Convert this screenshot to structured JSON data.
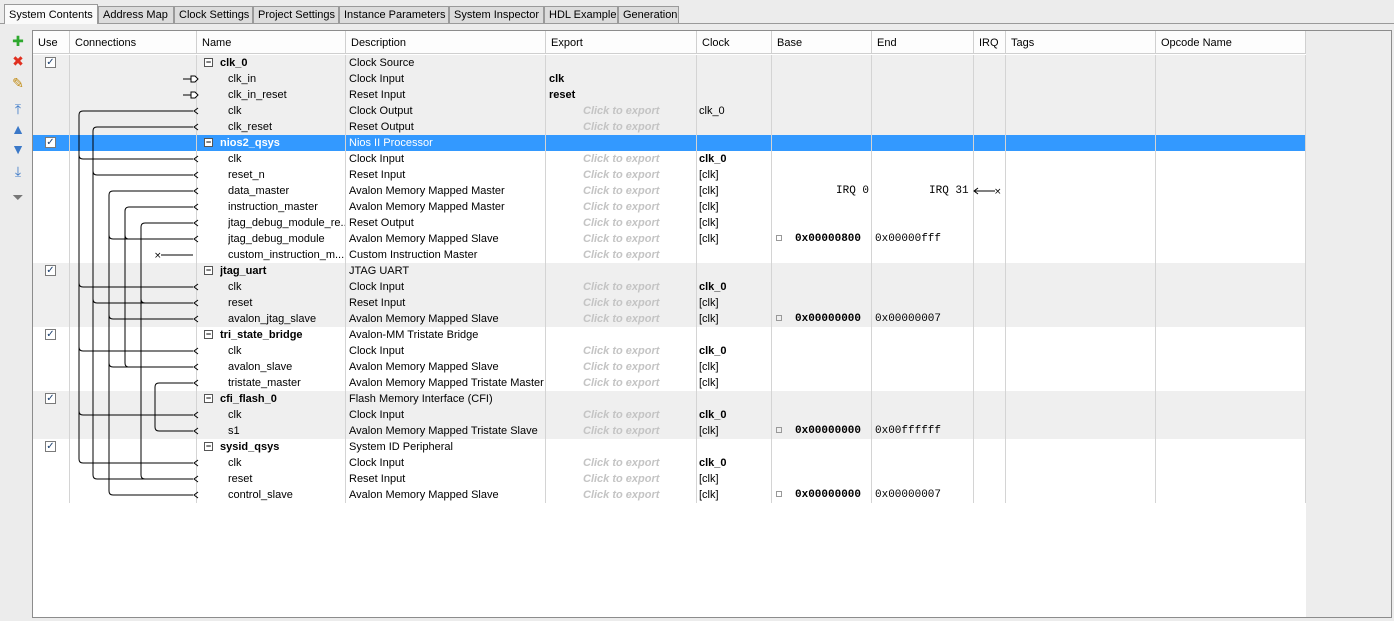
{
  "tabs": [
    {
      "label": "System Contents",
      "active": true
    },
    {
      "label": "Address Map"
    },
    {
      "label": "Clock Settings"
    },
    {
      "label": "Project Settings"
    },
    {
      "label": "Instance Parameters"
    },
    {
      "label": "System Inspector"
    },
    {
      "label": "HDL Example"
    },
    {
      "label": "Generation"
    }
  ],
  "toolbar": [
    {
      "name": "add-icon",
      "glyph": "✚",
      "color": "#2ea82e"
    },
    {
      "name": "remove-icon",
      "glyph": "✖",
      "color": "#e03020"
    },
    {
      "name": "edit-icon",
      "glyph": "✎",
      "color": "#c08a10"
    },
    {
      "name": "move-top-icon",
      "glyph": "⤒",
      "color": "#3a78c8"
    },
    {
      "name": "move-up-icon",
      "glyph": "▲",
      "color": "#3a78c8"
    },
    {
      "name": "move-down-icon",
      "glyph": "▼",
      "color": "#3a78c8"
    },
    {
      "name": "move-bottom-icon",
      "glyph": "⤓",
      "color": "#3a78c8"
    },
    {
      "name": "filter-icon",
      "glyph": "⏷",
      "color": "#777777"
    }
  ],
  "columns": [
    "Use",
    "Connections",
    "Name",
    "Description",
    "Export",
    "Clock",
    "Base",
    "End",
    "IRQ",
    "Tags",
    "Opcode Name"
  ],
  "export_placeholder": "Click to export",
  "rows": [
    {
      "type": "comp",
      "name": "clk_0",
      "desc": "Clock Source",
      "use": true
    },
    {
      "type": "iface",
      "name": "clk_in",
      "desc": "Clock Input",
      "export": "clk",
      "export_bold": true
    },
    {
      "type": "iface",
      "name": "clk_in_reset",
      "desc": "Reset Input",
      "export": "reset",
      "export_bold": true
    },
    {
      "type": "iface",
      "name": "clk",
      "desc": "Clock Output",
      "export_ph": true,
      "clock": "clk_0"
    },
    {
      "type": "iface",
      "name": "clk_reset",
      "desc": "Reset Output",
      "export_ph": true
    },
    {
      "type": "comp",
      "name": "nios2_qsys",
      "desc": "Nios II Processor",
      "use": true,
      "selected": true
    },
    {
      "type": "iface",
      "name": "clk",
      "desc": "Clock Input",
      "export_ph": true,
      "clock": "clk_0",
      "clock_bold": true
    },
    {
      "type": "iface",
      "name": "reset_n",
      "desc": "Reset Input",
      "export_ph": true,
      "clock": "[clk]"
    },
    {
      "type": "iface",
      "name": "data_master",
      "desc": "Avalon Memory Mapped Master",
      "export_ph": true,
      "clock": "[clk]",
      "irq_left": "IRQ 0",
      "irq_right": "IRQ 31"
    },
    {
      "type": "iface",
      "name": "instruction_master",
      "desc": "Avalon Memory Mapped Master",
      "export_ph": true,
      "clock": "[clk]"
    },
    {
      "type": "iface",
      "name": "jtag_debug_module_re...",
      "desc": "Reset Output",
      "export_ph": true,
      "clock": "[clk]"
    },
    {
      "type": "iface",
      "name": "jtag_debug_module",
      "desc": "Avalon Memory Mapped Slave",
      "export_ph": true,
      "clock": "[clk]",
      "base": "0x00000800",
      "end": "0x00000fff"
    },
    {
      "type": "iface",
      "name": "custom_instruction_m...",
      "desc": "Custom Instruction Master",
      "export_ph": true
    },
    {
      "type": "comp",
      "name": "jtag_uart",
      "desc": "JTAG UART",
      "use": true
    },
    {
      "type": "iface",
      "name": "clk",
      "desc": "Clock Input",
      "export_ph": true,
      "clock": "clk_0",
      "clock_bold": true
    },
    {
      "type": "iface",
      "name": "reset",
      "desc": "Reset Input",
      "export_ph": true,
      "clock": "[clk]"
    },
    {
      "type": "iface",
      "name": "avalon_jtag_slave",
      "desc": "Avalon Memory Mapped Slave",
      "export_ph": true,
      "clock": "[clk]",
      "base": "0x00000000",
      "end": "0x00000007"
    },
    {
      "type": "comp",
      "name": "tri_state_bridge",
      "desc": "Avalon-MM Tristate Bridge",
      "use": true
    },
    {
      "type": "iface",
      "name": "clk",
      "desc": "Clock Input",
      "export_ph": true,
      "clock": "clk_0",
      "clock_bold": true
    },
    {
      "type": "iface",
      "name": "avalon_slave",
      "desc": "Avalon Memory Mapped Slave",
      "export_ph": true,
      "clock": "[clk]"
    },
    {
      "type": "iface",
      "name": "tristate_master",
      "desc": "Avalon Memory Mapped Tristate Master",
      "export_ph": true,
      "clock": "[clk]"
    },
    {
      "type": "comp",
      "name": "cfi_flash_0",
      "desc": "Flash Memory Interface (CFI)",
      "use": true
    },
    {
      "type": "iface",
      "name": "clk",
      "desc": "Clock Input",
      "export_ph": true,
      "clock": "clk_0",
      "clock_bold": true
    },
    {
      "type": "iface",
      "name": "s1",
      "desc": "Avalon Memory Mapped Tristate Slave",
      "export_ph": true,
      "clock": "[clk]",
      "base": "0x00000000",
      "end": "0x00ffffff"
    },
    {
      "type": "comp",
      "name": "sysid_qsys",
      "desc": "System ID Peripheral",
      "use": true
    },
    {
      "type": "iface",
      "name": "clk",
      "desc": "Clock Input",
      "export_ph": true,
      "clock": "clk_0",
      "clock_bold": true
    },
    {
      "type": "iface",
      "name": "reset",
      "desc": "Reset Input",
      "export_ph": true,
      "clock": "[clk]"
    },
    {
      "type": "iface",
      "name": "control_slave",
      "desc": "Avalon Memory Mapped Slave",
      "export_ph": true,
      "clock": "[clk]",
      "base": "0x00000000",
      "end": "0x00000007"
    }
  ]
}
